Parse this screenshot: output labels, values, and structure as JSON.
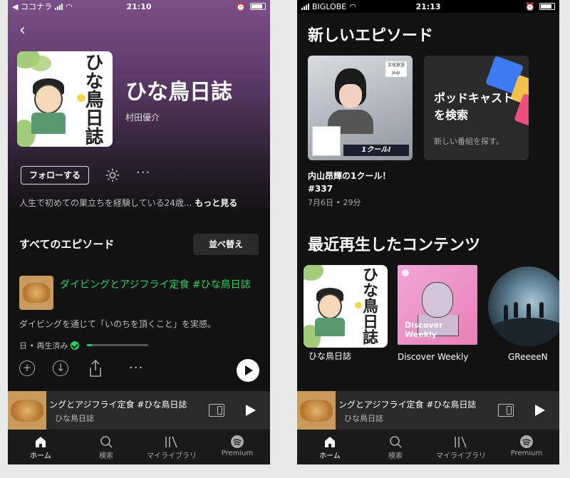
{
  "left": {
    "status": {
      "carrier": "◀ ココナラ",
      "time": "21:10"
    },
    "podcast": {
      "title": "ひな鳥日誌",
      "author": "村田優介",
      "cover_title": "ひな鳥日誌",
      "follow_label": "フォローする",
      "description": "人生で初めての巣立ちを経験している24歳...",
      "more_label": "もっと見る"
    },
    "episodes_section": {
      "title": "すべてのエピソード",
      "sort_label": "並べ替え"
    },
    "episode": {
      "title": "ダイビングとアジフライ定食 #ひな鳥日誌",
      "description": "ダイビングを通じて「いのちを頂くこと」を実感。",
      "played_label": "日 • 再生済み",
      "progress": 0.08
    },
    "mini_player": {
      "title": "ングとアジフライ定食 #ひな鳥日誌",
      "subtitle": "ひな鳥日誌"
    }
  },
  "right": {
    "status": {
      "carrier": "BIGLOBE",
      "time": "21:13"
    },
    "new_episodes_title": "新しいエピソード",
    "card_episode": {
      "name_line1": "内山昂輝の1クール！",
      "name_line2": "#337",
      "meta": "7月6日 • 29分",
      "banner": "1クール!",
      "logo": "文化放送 Joqr"
    },
    "card_search": {
      "title": "ポッドキャストを検索",
      "subtitle": "新しい番組を探す。"
    },
    "recent_title": "最近再生したコンテンツ",
    "recent": [
      {
        "label": "ひな鳥日誌",
        "cover_title": "ひな鳥日誌"
      },
      {
        "label": "Discover Weekly",
        "cover_text": "Discover Weekly"
      },
      {
        "label": "GReeeeN"
      }
    ],
    "mini_player": {
      "title": "ングとアジフライ定食 #ひな鳥日誌",
      "subtitle": "ひな鳥日誌"
    }
  },
  "tabs": [
    {
      "label": "ホーム",
      "icon": "home-icon"
    },
    {
      "label": "検索",
      "icon": "search-icon"
    },
    {
      "label": "マイライブラリ",
      "icon": "library-icon"
    },
    {
      "label": "Premium",
      "icon": "spotify-icon"
    }
  ],
  "colors": {
    "accent": "#1ed760",
    "background": "#121212",
    "hero": "#7a4f86"
  }
}
